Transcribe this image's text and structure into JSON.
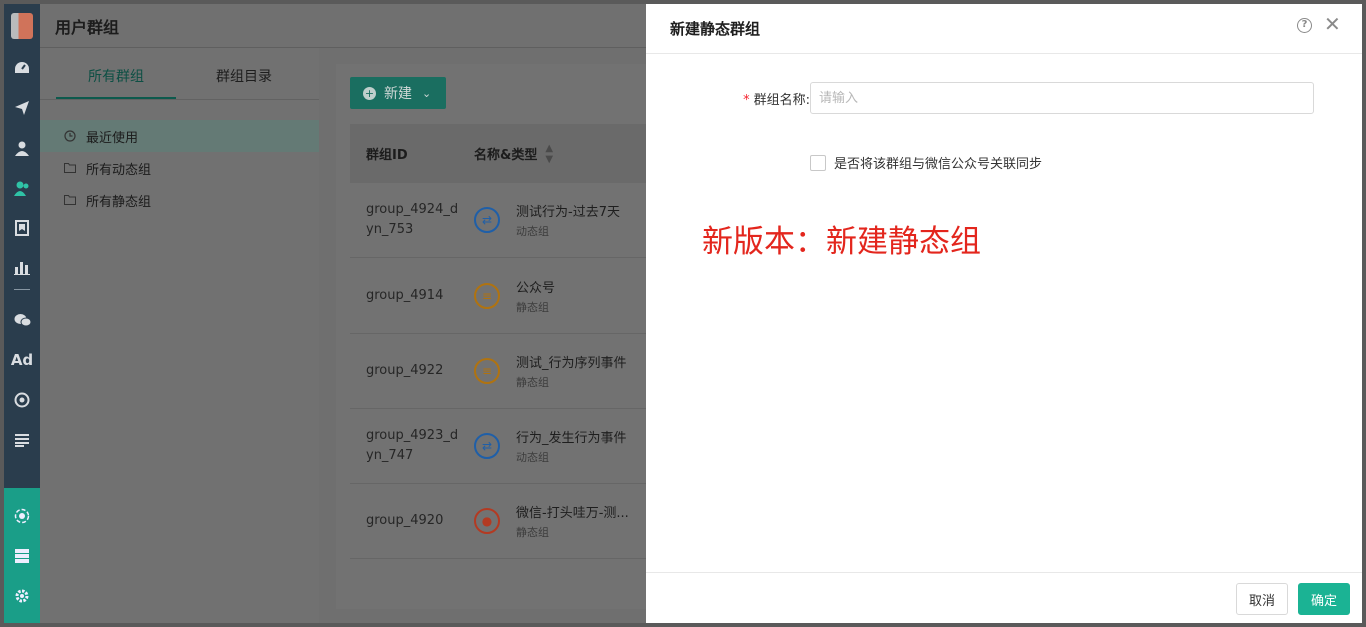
{
  "rail": {
    "items": [
      "dashboard-icon",
      "send-icon",
      "user-icon",
      "user-group-icon",
      "bookmark-icon",
      "bar-chart-icon",
      "wechat-icon",
      "Ad",
      "target-icon",
      "list-icon"
    ],
    "bottom_items": [
      "hub-icon",
      "server-icon",
      "gear-icon"
    ],
    "accent": "#2fc3a6"
  },
  "page": {
    "title": "用户群组",
    "tabs": [
      "所有群组",
      "群组目录"
    ],
    "tree": [
      {
        "label": "最近使用",
        "icon": "clock-icon"
      },
      {
        "label": "所有动态组",
        "icon": "folder-icon"
      },
      {
        "label": "所有静态组",
        "icon": "folder-icon"
      }
    ],
    "new_button": "新建",
    "table": {
      "headers": [
        "群组ID",
        "名称&类型"
      ],
      "rows": [
        {
          "id": "group_4924_d yn_753",
          "name": "测试行为-过去7天",
          "type": "动态组",
          "icon": "sync-icon",
          "color": "#1f5fa8"
        },
        {
          "id": "group_4914",
          "name": "公众号",
          "type": "静态组",
          "icon": "list-icon",
          "color": "#b07310"
        },
        {
          "id": "group_4922",
          "name": "测试_行为序列事件",
          "type": "静态组",
          "icon": "list-icon",
          "color": "#b07310"
        },
        {
          "id": "group_4923_d yn_747",
          "name": "行为_发生行为事件",
          "type": "动态组",
          "icon": "sync-icon",
          "color": "#1f5fa8"
        },
        {
          "id": "group_4920",
          "name": "微信-打头哇万-测...",
          "type": "静态组",
          "icon": "user-circle-icon",
          "color": "#b33a22"
        }
      ]
    }
  },
  "drawer": {
    "title": "新建静态群组",
    "name_label": "群组名称:",
    "name_placeholder": "请输入",
    "sync_label": "是否将该群组与微信公众号关联同步",
    "annotation": "新版本：新建静态组",
    "cancel": "取消",
    "confirm": "确定",
    "primary_color": "#1bb394"
  }
}
